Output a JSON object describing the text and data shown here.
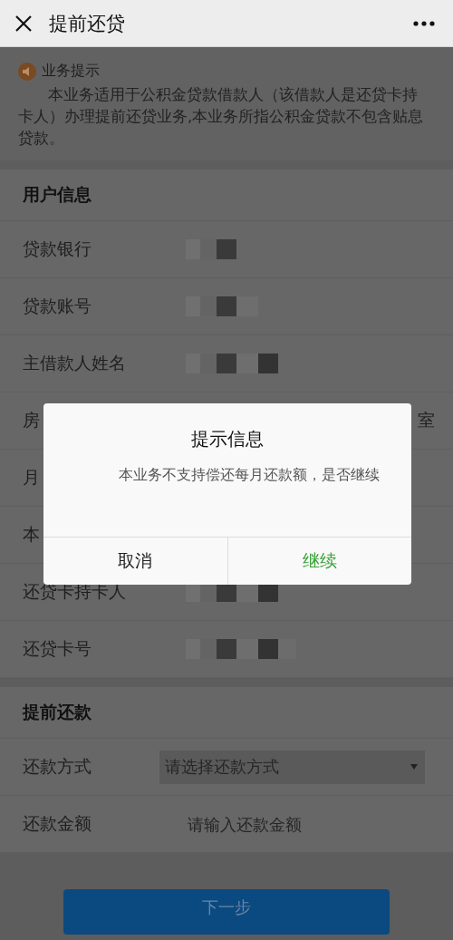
{
  "header": {
    "title": "提前还贷"
  },
  "notice": {
    "title": "业务提示",
    "text": "本业务适用于公积金贷款借款人（该借款人是还贷卡持卡人）办理提前还贷业务,本业务所指公积金贷款不包含贴息贷款。"
  },
  "user_info": {
    "title": "用户信息",
    "rows": [
      {
        "label": "贷款银行",
        "kind": "masked"
      },
      {
        "label": "贷款账号",
        "kind": "masked"
      },
      {
        "label": "主借款人姓名",
        "kind": "masked"
      },
      {
        "label": "房",
        "kind": "text",
        "value": "室"
      },
      {
        "label": "月",
        "kind": "none"
      },
      {
        "label": "本",
        "kind": "none"
      },
      {
        "label": "还贷卡持卡人",
        "kind": "masked"
      },
      {
        "label": "还贷卡号",
        "kind": "masked"
      }
    ]
  },
  "prepayment": {
    "title": "提前还款",
    "rows": [
      {
        "label": "还款方式",
        "kind": "select",
        "placeholder": "请选择还款方式"
      },
      {
        "label": "还款金额",
        "kind": "input",
        "placeholder": "请输入还款金额"
      }
    ]
  },
  "next_button": "下一步",
  "dialog": {
    "title": "提示信息",
    "message": "本业务不支持偿还每月还款额，是否继续",
    "buttons": [
      {
        "label": "取消",
        "primary": false
      },
      {
        "label": "继续",
        "primary": true
      }
    ]
  }
}
